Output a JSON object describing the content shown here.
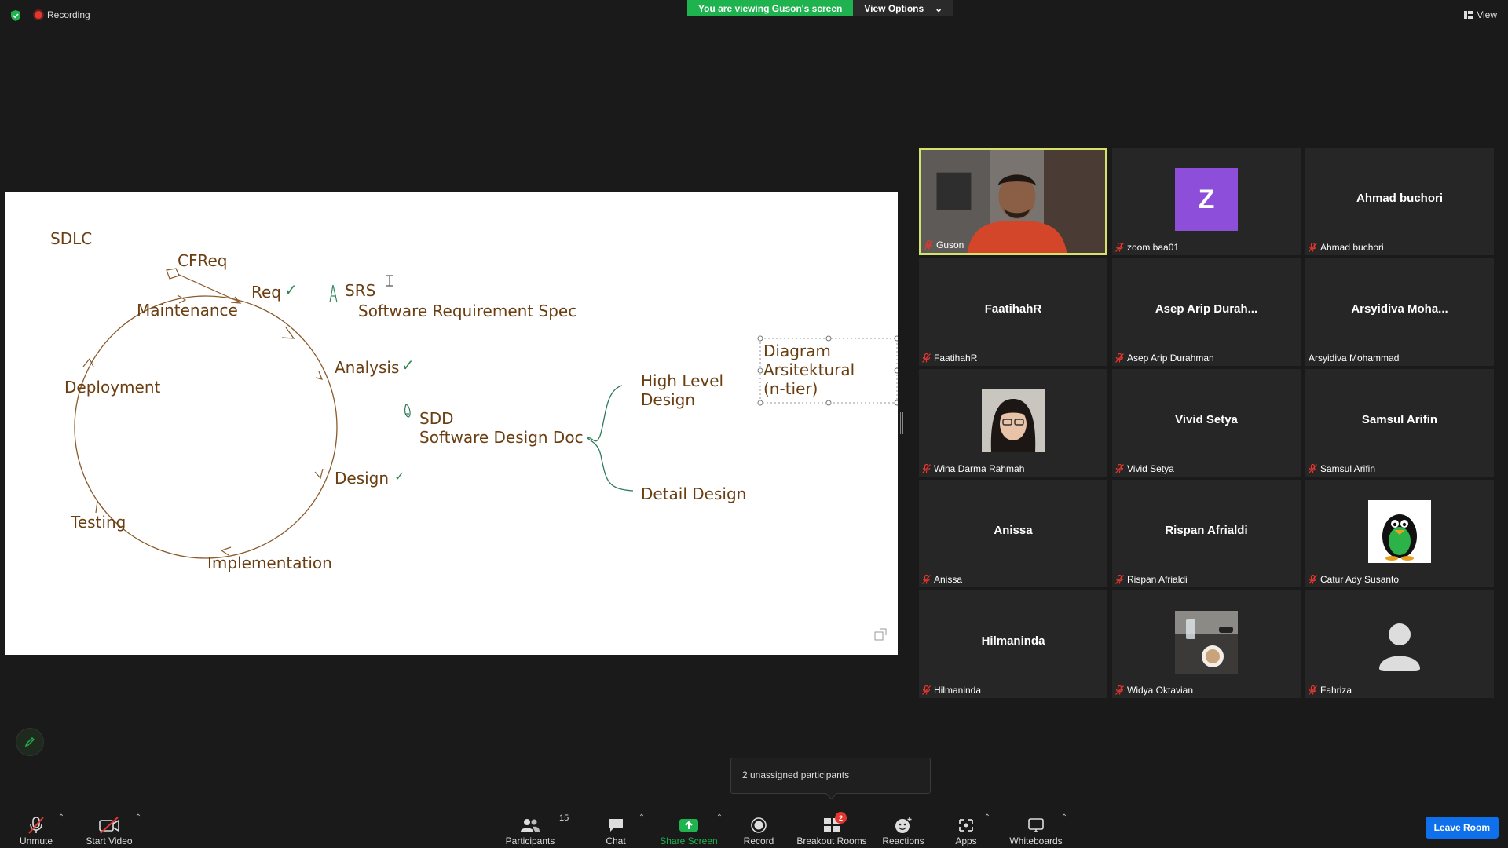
{
  "topbar": {
    "recording_label": "Recording",
    "viewing_label": "You are viewing Guson's screen",
    "view_options_label": "View Options",
    "view_label": "View"
  },
  "whiteboard": {
    "title": "SDLC",
    "stages": {
      "cfreq": "CFReq",
      "req": "Req",
      "maintenance": "Maintenance",
      "analysis": "Analysis",
      "deployment": "Deployment",
      "design": "Design",
      "testing": "Testing",
      "implementation": "Implementation"
    },
    "srs": "SRS",
    "srs_full": "Software Requirement Spec",
    "sdd": "SDD",
    "sdd_full": "Software Design Doc",
    "high_level_1": "High Level",
    "high_level_2": "Design",
    "detail_design": "Detail Design",
    "textbox": [
      "Diagram",
      "Arsitektural",
      "(n-tier)"
    ],
    "check": "✓",
    "ink_color": "#6b3e12",
    "check_color": "#2f8a5a"
  },
  "participants": [
    {
      "name": "Guson",
      "display": "",
      "kind": "video",
      "speaker": true
    },
    {
      "name": "zoom baa01",
      "display": "Z",
      "kind": "letter"
    },
    {
      "name": "Ahmad buchori",
      "display": "Ahmad buchori",
      "kind": "text"
    },
    {
      "name": "FaatihahR",
      "display": "FaatihahR",
      "kind": "text"
    },
    {
      "name": "Asep Arip Durahman",
      "display": "Asep Arip Durah...",
      "kind": "text"
    },
    {
      "name": "Arsyidiva Mohammad",
      "display": "Arsyidiva Moha...",
      "kind": "text",
      "unmuted": true
    },
    {
      "name": "Wina Darma Rahmah",
      "display": "",
      "kind": "photo-girl"
    },
    {
      "name": "Vivid Setya",
      "display": "Vivid Setya",
      "kind": "text"
    },
    {
      "name": "Samsul Arifin",
      "display": "Samsul Arifin",
      "kind": "text"
    },
    {
      "name": "Anissa",
      "display": "Anissa",
      "kind": "text"
    },
    {
      "name": "Rispan Afrialdi",
      "display": "Rispan Afrialdi",
      "kind": "text"
    },
    {
      "name": "Catur Ady Susanto",
      "display": "",
      "kind": "photo-penguin"
    },
    {
      "name": "Hilmaninda",
      "display": "Hilmaninda",
      "kind": "text"
    },
    {
      "name": "Widya Oktavian",
      "display": "",
      "kind": "photo-coffee"
    },
    {
      "name": "Fahriza",
      "display": "",
      "kind": "default-avatar"
    }
  ],
  "tooltip": "2 unassigned participants",
  "toolbar": {
    "unmute": "Unmute",
    "start_video": "Start Video",
    "participants": "Participants",
    "participants_count": "15",
    "chat": "Chat",
    "share_screen": "Share Screen",
    "record": "Record",
    "breakout_rooms": "Breakout Rooms",
    "breakout_badge": "2",
    "reactions": "Reactions",
    "apps": "Apps",
    "whiteboards": "Whiteboards",
    "leave": "Leave Room"
  },
  "colors": {
    "share_green": "#1fb350",
    "speaker_border": "#d6e36a",
    "leave_blue": "#0e71eb",
    "mute_red": "#e2362f"
  }
}
